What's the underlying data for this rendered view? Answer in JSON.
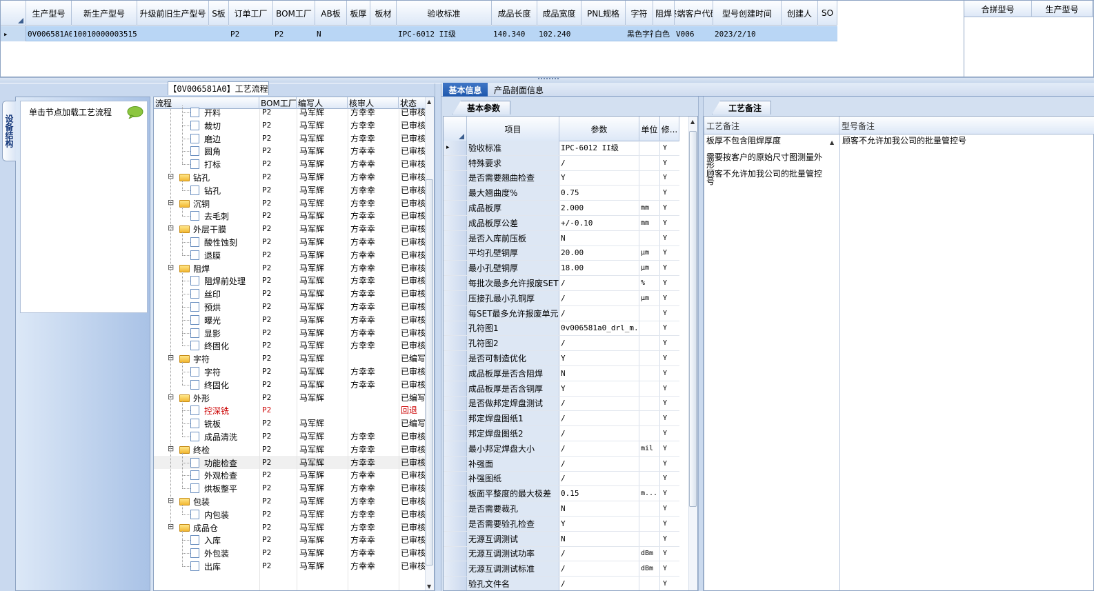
{
  "top_grid": {
    "columns": [
      "生产型号",
      "新生产型号",
      "升级前旧生产型号",
      "S板",
      "订单工厂",
      "BOM工厂",
      "AB板",
      "板厚",
      "板材",
      "验收标准",
      "成品长度",
      "成品宽度",
      "PNL规格",
      "字符",
      "阻焊",
      "终端客户代码",
      "型号创建时间",
      "创建人",
      "SO"
    ],
    "row": [
      "0V006581A0",
      "10010000003515",
      "",
      "",
      "P2",
      "P2",
      "N",
      "",
      "",
      "IPC-6012 II级",
      "140.340",
      "102.240",
      "",
      "黑色字符",
      "白色",
      "V006",
      "2023/2/10",
      "",
      ""
    ],
    "row_marker": "▸"
  },
  "right_grid": {
    "columns": [
      "合拼型号",
      "生产型号"
    ]
  },
  "flow_panel": {
    "title": "【0V006581A0】工艺流程",
    "side_tab": "设备结构",
    "hint": "单击节点加载工艺流程",
    "columns": [
      "流程",
      "BOM工厂",
      "编写人",
      "核审人",
      "状态"
    ],
    "rows": [
      {
        "name": "开料",
        "level": 2,
        "bom": "P2",
        "writer": "马军辉",
        "reviewer": "方幸幸",
        "status": "已审核",
        "cut": true
      },
      {
        "name": "裁切",
        "level": 2,
        "bom": "P2",
        "writer": "马军辉",
        "reviewer": "方幸幸",
        "status": "已审核"
      },
      {
        "name": "磨边",
        "level": 2,
        "bom": "P2",
        "writer": "马军辉",
        "reviewer": "方幸幸",
        "status": "已审核"
      },
      {
        "name": "圆角",
        "level": 2,
        "bom": "P2",
        "writer": "马军辉",
        "reviewer": "方幸幸",
        "status": "已审核"
      },
      {
        "name": "打标",
        "level": 2,
        "bom": "P2",
        "writer": "马军辉",
        "reviewer": "方幸幸",
        "status": "已审核"
      },
      {
        "name": "钻孔",
        "level": 1,
        "bom": "P2",
        "writer": "马军辉",
        "reviewer": "方幸幸",
        "status": "已审核"
      },
      {
        "name": "钻孔",
        "level": 2,
        "bom": "P2",
        "writer": "马军辉",
        "reviewer": "方幸幸",
        "status": "已审核"
      },
      {
        "name": "沉铜",
        "level": 1,
        "bom": "P2",
        "writer": "马军辉",
        "reviewer": "方幸幸",
        "status": "已审核"
      },
      {
        "name": "去毛刺",
        "level": 2,
        "bom": "P2",
        "writer": "马军辉",
        "reviewer": "方幸幸",
        "status": "已审核"
      },
      {
        "name": "外层干膜",
        "level": 1,
        "bom": "P2",
        "writer": "马军辉",
        "reviewer": "方幸幸",
        "status": "已审核"
      },
      {
        "name": "酸性蚀刻",
        "level": 2,
        "bom": "P2",
        "writer": "马军辉",
        "reviewer": "方幸幸",
        "status": "已审核"
      },
      {
        "name": "退膜",
        "level": 2,
        "bom": "P2",
        "writer": "马军辉",
        "reviewer": "方幸幸",
        "status": "已审核"
      },
      {
        "name": "阻焊",
        "level": 1,
        "bom": "P2",
        "writer": "马军辉",
        "reviewer": "方幸幸",
        "status": "已审核"
      },
      {
        "name": "阻焊前处理",
        "level": 2,
        "bom": "P2",
        "writer": "马军辉",
        "reviewer": "方幸幸",
        "status": "已审核"
      },
      {
        "name": "丝印",
        "level": 2,
        "bom": "P2",
        "writer": "马军辉",
        "reviewer": "方幸幸",
        "status": "已审核"
      },
      {
        "name": "预烘",
        "level": 2,
        "bom": "P2",
        "writer": "马军辉",
        "reviewer": "方幸幸",
        "status": "已审核"
      },
      {
        "name": "曝光",
        "level": 2,
        "bom": "P2",
        "writer": "马军辉",
        "reviewer": "方幸幸",
        "status": "已审核"
      },
      {
        "name": "显影",
        "level": 2,
        "bom": "P2",
        "writer": "马军辉",
        "reviewer": "方幸幸",
        "status": "已审核"
      },
      {
        "name": "终固化",
        "level": 2,
        "bom": "P2",
        "writer": "马军辉",
        "reviewer": "方幸幸",
        "status": "已审核"
      },
      {
        "name": "字符",
        "level": 1,
        "bom": "P2",
        "writer": "马军辉",
        "reviewer": "",
        "status": "已编写"
      },
      {
        "name": "字符",
        "level": 2,
        "bom": "P2",
        "writer": "马军辉",
        "reviewer": "方幸幸",
        "status": "已审核"
      },
      {
        "name": "终固化",
        "level": 2,
        "bom": "P2",
        "writer": "马军辉",
        "reviewer": "方幸幸",
        "status": "已审核"
      },
      {
        "name": "外形",
        "level": 1,
        "bom": "P2",
        "writer": "马军辉",
        "reviewer": "",
        "status": "已编写"
      },
      {
        "name": "控深铣",
        "level": 2,
        "bom": "P2",
        "writer": "",
        "reviewer": "",
        "status": "回退",
        "red": true
      },
      {
        "name": "铣板",
        "level": 2,
        "bom": "P2",
        "writer": "马军辉",
        "reviewer": "",
        "status": "已编写"
      },
      {
        "name": "成品清洗",
        "level": 2,
        "bom": "P2",
        "writer": "马军辉",
        "reviewer": "方幸幸",
        "status": "已审核"
      },
      {
        "name": "终检",
        "level": 1,
        "bom": "P2",
        "writer": "马军辉",
        "reviewer": "方幸幸",
        "status": "已审核"
      },
      {
        "name": "功能检查",
        "level": 2,
        "bom": "P2",
        "writer": "马军辉",
        "reviewer": "方幸幸",
        "status": "已审核",
        "selected": true
      },
      {
        "name": "外观检查",
        "level": 2,
        "bom": "P2",
        "writer": "马军辉",
        "reviewer": "方幸幸",
        "status": "已审核"
      },
      {
        "name": "烘板整平",
        "level": 2,
        "bom": "P2",
        "writer": "马军辉",
        "reviewer": "方幸幸",
        "status": "已审核"
      },
      {
        "name": "包装",
        "level": 1,
        "bom": "P2",
        "writer": "马军辉",
        "reviewer": "方幸幸",
        "status": "已审核"
      },
      {
        "name": "内包装",
        "level": 2,
        "bom": "P2",
        "writer": "马军辉",
        "reviewer": "方幸幸",
        "status": "已审核"
      },
      {
        "name": "成品仓",
        "level": 1,
        "bom": "P2",
        "writer": "马军辉",
        "reviewer": "方幸幸",
        "status": "已审核"
      },
      {
        "name": "入库",
        "level": 2,
        "bom": "P2",
        "writer": "马军辉",
        "reviewer": "方幸幸",
        "status": "已审核"
      },
      {
        "name": "外包装",
        "level": 2,
        "bom": "P2",
        "writer": "马军辉",
        "reviewer": "方幸幸",
        "status": "已审核"
      },
      {
        "name": "出库",
        "level": 2,
        "bom": "P2",
        "writer": "马军辉",
        "reviewer": "方幸幸",
        "status": "已审核"
      }
    ]
  },
  "info_tabs": {
    "basic": "基本信息",
    "profile": "产品剖面信息"
  },
  "param_panel": {
    "tab": "基本参数",
    "columns": [
      "项目",
      "参数",
      "单位",
      "修..."
    ],
    "rows": [
      {
        "item": "验收标准",
        "param": "IPC-6012 II级",
        "unit": "",
        "mod": "Y",
        "current": true
      },
      {
        "item": "特殊要求",
        "param": "/",
        "unit": "",
        "mod": "Y"
      },
      {
        "item": "是否需要翘曲检查",
        "param": "Y",
        "unit": "",
        "mod": "Y"
      },
      {
        "item": "最大翘曲度%",
        "param": "0.75",
        "unit": "",
        "mod": "Y"
      },
      {
        "item": "成品板厚",
        "param": "2.000",
        "unit": "mm",
        "mod": "Y"
      },
      {
        "item": "成品板厚公差",
        "param": "+/-0.10",
        "unit": "mm",
        "mod": "Y"
      },
      {
        "item": "是否入库前压板",
        "param": "N",
        "unit": "",
        "mod": "Y"
      },
      {
        "item": "平均孔壁铜厚",
        "param": "20.00",
        "unit": "μm",
        "mod": "Y"
      },
      {
        "item": "最小孔壁铜厚",
        "param": "18.00",
        "unit": "μm",
        "mod": "Y"
      },
      {
        "item": "每批次最多允许报废SET",
        "param": "/",
        "unit": "%",
        "mod": "Y"
      },
      {
        "item": "压接孔最小孔铜厚",
        "param": "/",
        "unit": "μm",
        "mod": "Y"
      },
      {
        "item": "每SET最多允许报废单元",
        "param": "/",
        "unit": "",
        "mod": "Y"
      },
      {
        "item": "孔符图1",
        "param": "0v006581a0_drl_m...",
        "unit": "",
        "mod": "Y"
      },
      {
        "item": "孔符图2",
        "param": "/",
        "unit": "",
        "mod": "Y"
      },
      {
        "item": "是否可制造优化",
        "param": "Y",
        "unit": "",
        "mod": "Y"
      },
      {
        "item": "成品板厚是否含阻焊",
        "param": "N",
        "unit": "",
        "mod": "Y"
      },
      {
        "item": "成品板厚是否含铜厚",
        "param": "Y",
        "unit": "",
        "mod": "Y"
      },
      {
        "item": "是否做邦定焊盘测试",
        "param": "/",
        "unit": "",
        "mod": "Y"
      },
      {
        "item": "邦定焊盘图纸1",
        "param": "/",
        "unit": "",
        "mod": "Y"
      },
      {
        "item": "邦定焊盘图纸2",
        "param": "/",
        "unit": "",
        "mod": "Y"
      },
      {
        "item": "最小邦定焊盘大小",
        "param": "/",
        "unit": "mil",
        "mod": "Y"
      },
      {
        "item": "补强面",
        "param": "/",
        "unit": "",
        "mod": "Y"
      },
      {
        "item": "补强图纸",
        "param": "/",
        "unit": "",
        "mod": "Y"
      },
      {
        "item": "板面平整度的最大极差",
        "param": "0.15",
        "unit": "m...",
        "mod": "Y"
      },
      {
        "item": "是否需要裁孔",
        "param": "N",
        "unit": "",
        "mod": "Y"
      },
      {
        "item": "是否需要验孔检查",
        "param": "Y",
        "unit": "",
        "mod": "Y"
      },
      {
        "item": "无源互调测试",
        "param": "N",
        "unit": "",
        "mod": "Y"
      },
      {
        "item": "无源互调测试功率",
        "param": "/",
        "unit": "dBm",
        "mod": "Y"
      },
      {
        "item": "无源互调测试标准",
        "param": "/",
        "unit": "dBm",
        "mod": "Y"
      },
      {
        "item": "验孔文件名",
        "param": "/",
        "unit": "",
        "mod": "Y"
      }
    ]
  },
  "notes_panel": {
    "tab": "工艺备注",
    "columns": [
      "工艺备注",
      "型号备注"
    ],
    "process_notes": [
      "板厚不包含阻焊厚度",
      "需要按客户的原始尺寸图测量外形",
      "顾客不允许加我公司的批量管控号"
    ],
    "model_notes": [
      "顾客不允许加我公司的批量管控号"
    ]
  },
  "colors": {
    "selection": "#b9d6f5",
    "accent": "#1f58ad",
    "return_red": "#cc0000"
  }
}
